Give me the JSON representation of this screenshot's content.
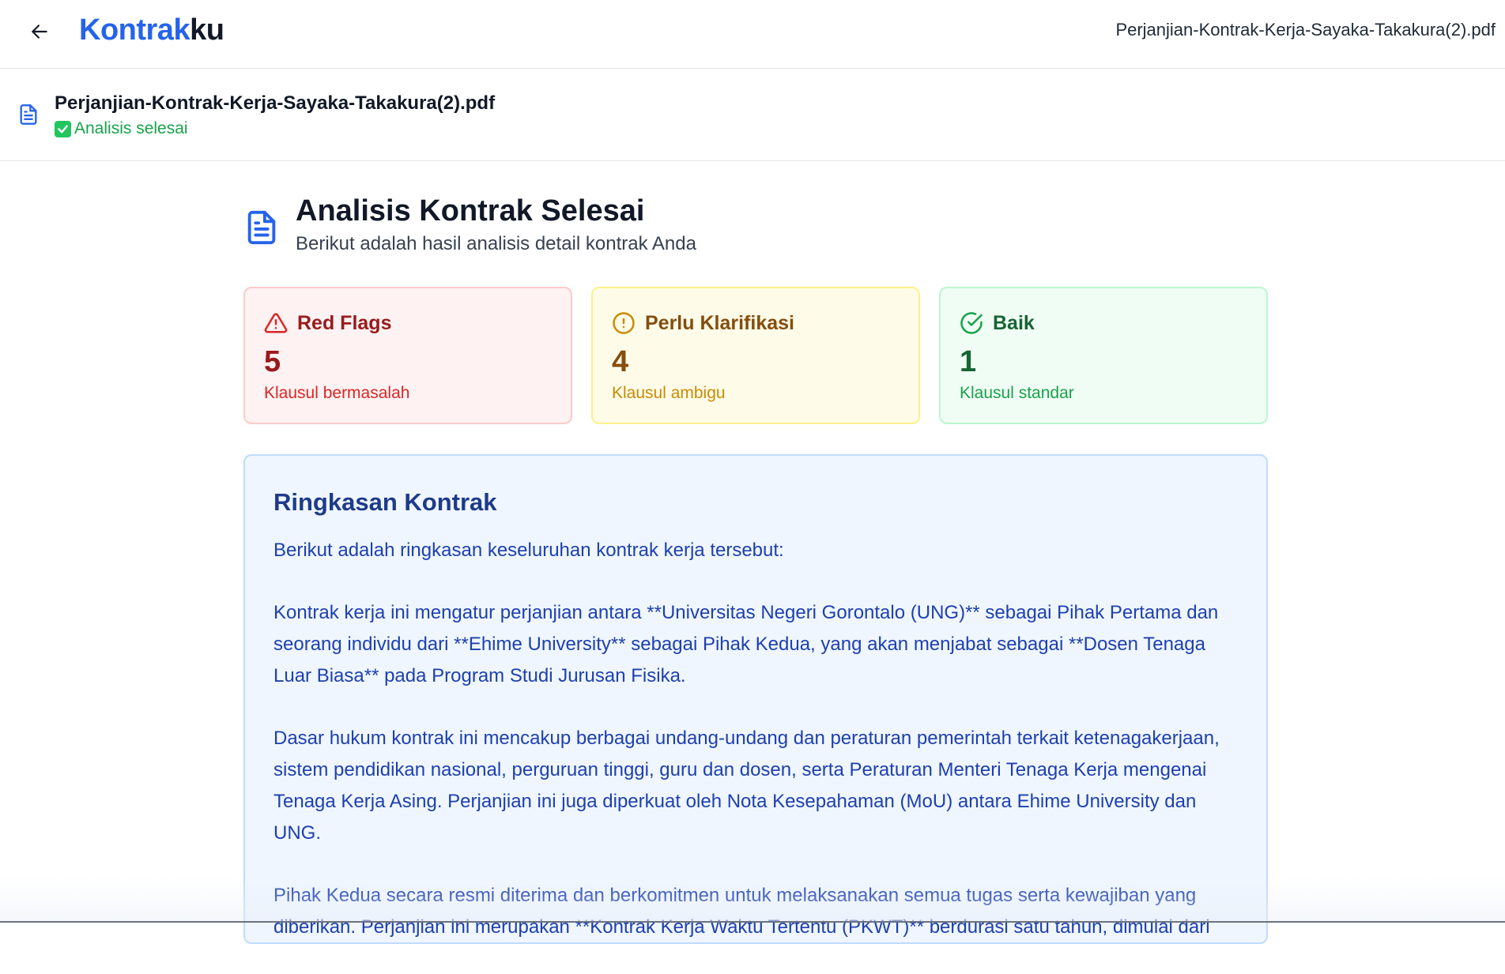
{
  "app": {
    "brand_part1": "Kontrak",
    "brand_part2": "ku",
    "current_file": "Perjanjian-Kontrak-Kerja-Sayaka-Takakura(2).pdf"
  },
  "file_bar": {
    "filename": "Perjanjian-Kontrak-Kerja-Sayaka-Takakura(2).pdf",
    "status": "Analisis selesai",
    "status_icon": "check-mark-button-icon"
  },
  "header": {
    "title": "Analisis Kontrak Selesai",
    "subtitle": "Berikut adalah hasil analisis detail kontrak Anda"
  },
  "cards": [
    {
      "title": "Red Flags",
      "count": "5",
      "description": "Klausul bermasalah",
      "icon": "alert-triangle-icon",
      "accent": "#991b1b"
    },
    {
      "title": "Perlu Klarifikasi",
      "count": "4",
      "description": "Klausul ambigu",
      "icon": "alert-circle-icon",
      "accent": "#ca8a04"
    },
    {
      "title": "Baik",
      "count": "1",
      "description": "Klausul standar",
      "icon": "check-circle-icon",
      "accent": "#16a34a"
    }
  ],
  "summary": {
    "title": "Ringkasan Kontrak",
    "paragraphs": [
      "Berikut adalah ringkasan keseluruhan kontrak kerja tersebut:",
      "Kontrak kerja ini mengatur perjanjian antara **Universitas Negeri Gorontalo (UNG)** sebagai Pihak Pertama dan seorang individu dari **Ehime University** sebagai Pihak Kedua, yang akan menjabat sebagai **Dosen Tenaga Luar Biasa** pada Program Studi Jurusan Fisika.",
      "Dasar hukum kontrak ini mencakup berbagai undang-undang dan peraturan pemerintah terkait ketenagakerjaan, sistem pendidikan nasional, perguruan tinggi, guru dan dosen, serta Peraturan Menteri Tenaga Kerja mengenai Tenaga Kerja Asing. Perjanjian ini juga diperkuat oleh Nota Kesepahaman (MoU) antara Ehime University dan UNG.",
      "Pihak Kedua secara resmi diterima dan berkomitmen untuk melaksanakan semua tugas serta kewajiban yang diberikan. Perjanjian ini merupakan **Kontrak Kerja Waktu Tertentu (PKWT)** berdurasi satu tahun, dimulai dari"
    ]
  }
}
